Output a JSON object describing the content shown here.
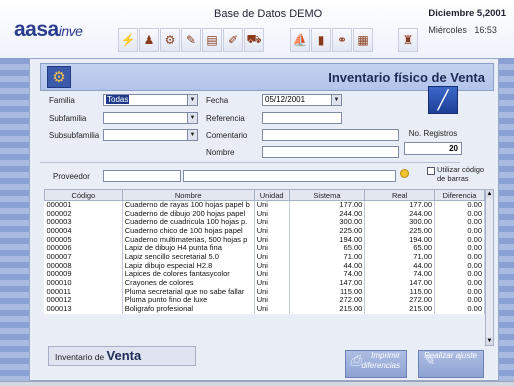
{
  "app": {
    "logo_main": "aasa",
    "logo_sub": "inve",
    "db_title": "Base de Datos DEMO",
    "date_line": "Diciembre 5,2001",
    "day": "Miércoles",
    "time": "16:53"
  },
  "toolbar": {
    "icons": [
      "bolt-icon",
      "people-icon",
      "gear-icon",
      "tag-icon",
      "book-icon",
      "pencil-icon",
      "truck-icon",
      "ship-icon",
      "folder-icon",
      "network-icon",
      "chart-icon",
      "person-icon"
    ]
  },
  "header": {
    "title": "Inventario físico de Venta",
    "icon": "gear-icon"
  },
  "form": {
    "familia_label": "Familia",
    "familia_value": "Todas",
    "subfamilia_label": "Subfamilia",
    "subsubfamilia_label": "Subsubfamilia",
    "fecha_label": "Fecha",
    "fecha_value": "05/12/2001",
    "referencia_label": "Referencia",
    "comentario_label": "Comentario",
    "nombre_label": "Nombre",
    "proveedor_label": "Proveedor",
    "nregistros_label": "No. Registros",
    "nregistros_value": "20",
    "codigo_barras_label": "Utilizar código de barras"
  },
  "table": {
    "columns": [
      "Código",
      "Nombre",
      "Unidad",
      "Sistema",
      "Real",
      "Diferencia"
    ],
    "rows": [
      [
        "000001",
        "Cuaderno de rayas 100 hojas papel b",
        "Uni",
        "177.00",
        "177.00",
        "0.00"
      ],
      [
        "000002",
        "Cuaderno de dibujo 200 hojas papel",
        "Uni",
        "244.00",
        "244.00",
        "0.00"
      ],
      [
        "000003",
        "Cuaderno de cuadricula 100 hojas p.",
        "Uni",
        "300.00",
        "300.00",
        "0.00"
      ],
      [
        "000004",
        "Cuaderno chico de 100 hojas papel",
        "Uni",
        "225.00",
        "225.00",
        "0.00"
      ],
      [
        "000005",
        "Cuaderno multimaterias, 500 hojas p",
        "Uni",
        "194.00",
        "194.00",
        "0.00"
      ],
      [
        "000006",
        "Lapiz de dibujo H4 punta fina",
        "Uni",
        "65.00",
        "65.00",
        "0.00"
      ],
      [
        "000007",
        "Lapiz sencillo secretarial 5.0",
        "Uni",
        "71.00",
        "71.00",
        "0.00"
      ],
      [
        "000008",
        "Lapiz dibujo especial H2.8",
        "Uni",
        "44.00",
        "44.00",
        "0.00"
      ],
      [
        "000009",
        "Lapices de colores fantasycolor",
        "Uni",
        "74.00",
        "74.00",
        "0.00"
      ],
      [
        "000010",
        "Crayones de colores",
        "Uni",
        "147.00",
        "147.00",
        "0.00"
      ],
      [
        "000011",
        "Pluma secretarial que no sabe fallar",
        "Uni",
        "115.00",
        "115.00",
        "0.00"
      ],
      [
        "000012",
        "Pluma punto fino de luxe",
        "Uni",
        "272.00",
        "272.00",
        "0.00"
      ],
      [
        "000013",
        "Boligrafo profesional",
        "Uni",
        "215.00",
        "215.00",
        "0.00"
      ]
    ]
  },
  "footer": {
    "inv_label_small": "Inventario de",
    "inv_label_big": "Venta",
    "print_button": "Imprimir diferencias",
    "adjust_button": "Realizar ajuste"
  }
}
